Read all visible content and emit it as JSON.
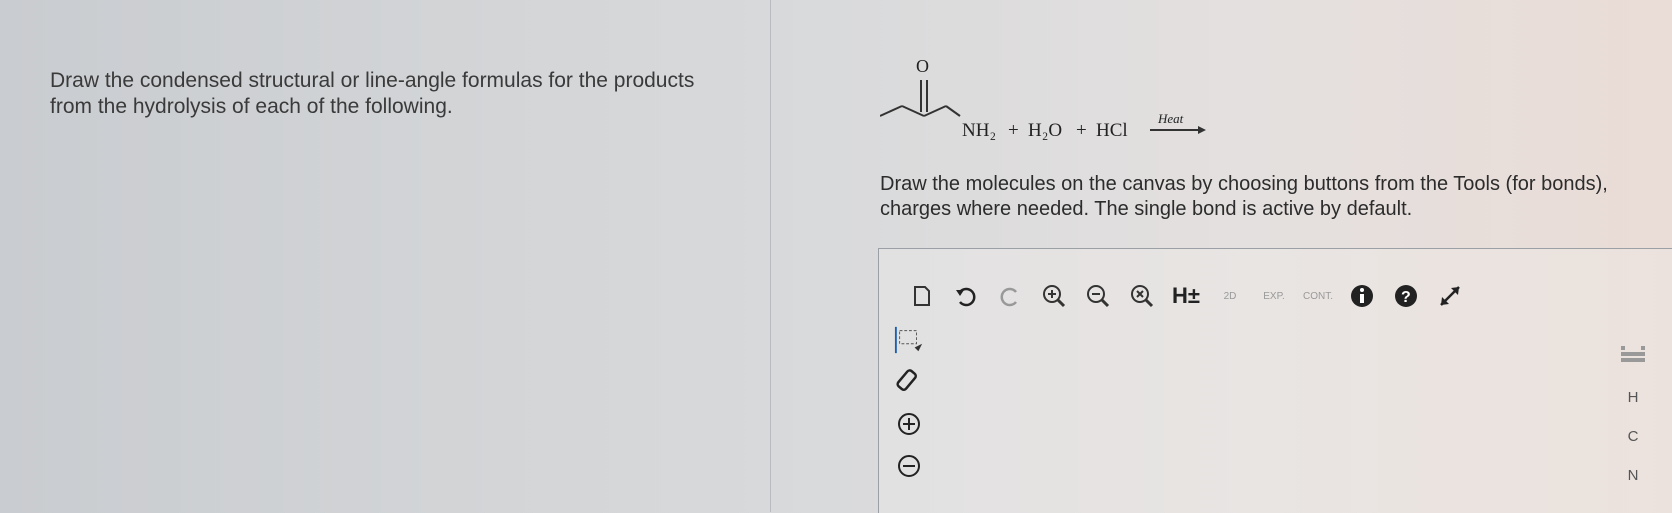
{
  "question": {
    "text": "Draw the condensed structural or line-angle formulas for the products from the hydrolysis of each of the following."
  },
  "reaction": {
    "carbonyl_o": "O",
    "amide_group": "NH₂",
    "plus1": "+",
    "water": "H₂O",
    "plus2": "+",
    "acid": "HCl",
    "condition": "Heat"
  },
  "instructions": {
    "text": "Draw the molecules on the canvas by choosing buttons from the Tools (for bonds), charges where needed. The single bond is active by default."
  },
  "toolbar": {
    "h_toggle_label": "H±",
    "twoD_label": "2D",
    "exp_label": "EXP.",
    "cont_label": "CONT."
  },
  "atoms": {
    "h": "H",
    "c": "C",
    "n": "N"
  },
  "colors": {
    "text": "#333333",
    "icon_dark": "#222222",
    "selection_blue": "#1a5fb4"
  }
}
